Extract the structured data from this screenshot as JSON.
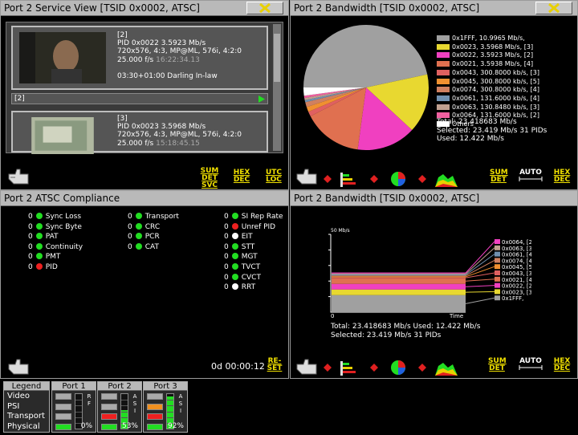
{
  "panels": {
    "service": {
      "title": "Port 2 Service View  [TSID 0x0002, ATSC]",
      "services": [
        {
          "num": "[2]",
          "pid": "PID 0x0022   3.5923 Mb/s",
          "fmt": "720x576, 4:3, MP@ML, 576i, 4:2:0",
          "rate": "25.000 f/s",
          "time": "16:22:34.13",
          "prog": "03:30+01:00 Darling In-law",
          "footer": "[2]"
        },
        {
          "num": "[3]",
          "pid": "PID 0x0023   3.5968 Mb/s",
          "fmt": "720x576, 4:3, MP@ML, 576i, 4:2:0",
          "rate": "25.000 f/s",
          "time": "15:18:45.15"
        }
      ],
      "btn_sum": [
        "SUM",
        "DET",
        "SVC"
      ],
      "btn_hex": [
        "HEX",
        "DEC"
      ],
      "btn_utc": [
        "UTC",
        "LOC"
      ]
    },
    "bandwidth_pie": {
      "title": "Port 2 Bandwidth  [TSID 0x0002, ATSC]",
      "total": "Total: 23.418683 Mb/s",
      "selected": "Selected: 23.419 Mb/s 31 PIDs",
      "used": "Used: 12.422 Mb/s",
      "btn_sum": [
        "SUM",
        "DET"
      ],
      "btn_auto": "AUTO",
      "btn_hex": [
        "HEX",
        "DEC"
      ]
    },
    "compliance": {
      "title": "Port 2 ATSC Compliance",
      "col1": [
        {
          "count": "0",
          "label": "Sync Loss",
          "status": "green"
        },
        {
          "count": "0",
          "label": "Sync Byte",
          "status": "green"
        },
        {
          "count": "0",
          "label": "PAT",
          "status": "green"
        },
        {
          "count": "0",
          "label": "Continuity",
          "status": "green"
        },
        {
          "count": "0",
          "label": "PMT",
          "status": "green"
        },
        {
          "count": "0",
          "label": "PID",
          "status": "red"
        }
      ],
      "col2": [
        {
          "count": "0",
          "label": "Transport",
          "status": "green"
        },
        {
          "count": "0",
          "label": "CRC",
          "status": "green"
        },
        {
          "count": "0",
          "label": "PCR",
          "status": "green"
        },
        {
          "count": "0",
          "label": "CAT",
          "status": "green"
        }
      ],
      "col3": [
        {
          "count": "0",
          "label": "SI Rep Rate",
          "status": "green"
        },
        {
          "count": "0",
          "label": "Unref PID",
          "status": "red"
        },
        {
          "count": "0",
          "label": "EIT",
          "status": "white"
        },
        {
          "count": "0",
          "label": "STT",
          "status": "green"
        },
        {
          "count": "0",
          "label": "MGT",
          "status": "green"
        },
        {
          "count": "0",
          "label": "TVCT",
          "status": "green"
        },
        {
          "count": "0",
          "label": "CVCT",
          "status": "green"
        },
        {
          "count": "0",
          "label": "RRT",
          "status": "white"
        }
      ],
      "timer": "0d 00:00:12",
      "reset": [
        "RE-",
        "SET"
      ]
    },
    "bandwidth_time": {
      "title": "Port 2 Bandwidth  [TSID 0x0002, ATSC]",
      "ymax": "50 Mb/s",
      "x0": "0",
      "xlabel": "Time",
      "total": "Total: 23.418683 Mb/s   Used: 12.422 Mb/s",
      "selected": "Selected: 23.419 Mb/s 31 PIDs",
      "btn_sum": [
        "SUM",
        "DET"
      ],
      "btn_auto": "AUTO",
      "btn_hex": [
        "HEX",
        "DEC"
      ]
    }
  },
  "chart_data": [
    {
      "type": "pie",
      "series": [
        {
          "name": "0x1FFF, 10.9965 Mb/s,",
          "value": 10.9965,
          "color": "#a0a0a0"
        },
        {
          "name": "0x0023, 3.5968 Mb/s, [3]",
          "value": 3.5968,
          "color": "#e8d830"
        },
        {
          "name": "0x0022, 3.5923 Mb/s, [2]",
          "value": 3.5923,
          "color": "#f040c0"
        },
        {
          "name": "0x0021, 3.5938 Mb/s, [4]",
          "value": 3.5938,
          "color": "#e07050"
        },
        {
          "name": "0x0043, 300.8000 kb/s, [3]",
          "value": 0.3008,
          "color": "#e06060"
        },
        {
          "name": "0x0045, 300.8000 kb/s, [5]",
          "value": 0.3008,
          "color": "#f09030"
        },
        {
          "name": "0x0074, 300.8000 kb/s, [4]",
          "value": 0.3008,
          "color": "#d08060"
        },
        {
          "name": "0x0061, 131.6000 kb/s, [4]",
          "value": 0.1316,
          "color": "#7090b0"
        },
        {
          "name": "0x0063, 130.8480 kb/s, [3]",
          "value": 0.1308,
          "color": "#c0a090"
        },
        {
          "name": "0x0064, 131.6000 kb/s, [2]",
          "value": 0.1316,
          "color": "#f060a0"
        },
        {
          "name": "Others",
          "value": 0.5,
          "color": "#ffffff"
        }
      ]
    },
    {
      "type": "area",
      "ylim": [
        0,
        50
      ],
      "series": [
        {
          "name": "0x0064, [2]",
          "value": 0.13,
          "color": "#f040c0"
        },
        {
          "name": "0x0063, [3]",
          "value": 0.13,
          "color": "#c0a090"
        },
        {
          "name": "0x0061, [4]",
          "value": 0.13,
          "color": "#7090b0"
        },
        {
          "name": "0x0074, [4]",
          "value": 0.3,
          "color": "#d08060"
        },
        {
          "name": "0x0045, [5]",
          "value": 0.3,
          "color": "#f09030"
        },
        {
          "name": "0x0043, [3]",
          "value": 0.3,
          "color": "#e06060"
        },
        {
          "name": "0x0021, [4]",
          "value": 3.59,
          "color": "#e07050"
        },
        {
          "name": "0x0022, [2]",
          "value": 3.59,
          "color": "#f040c0"
        },
        {
          "name": "0x0023, [3]",
          "value": 3.6,
          "color": "#e8d830"
        },
        {
          "name": "0x1FFF,",
          "value": 11.0,
          "color": "#a0a0a0"
        }
      ]
    }
  ],
  "legend": {
    "title": "Legend",
    "rows": [
      "Video",
      "PSI",
      "Transport",
      "Physical"
    ],
    "ports": [
      {
        "name": "Port 1",
        "side": "R F",
        "pct": "0%",
        "bars": [
          "#aaaaaa",
          "#aaaaaa",
          "#aaaaaa",
          "#22dd22"
        ],
        "level": 0
      },
      {
        "name": "Port 2",
        "side": "A S I",
        "pct": "53%",
        "bars": [
          "#aaaaaa",
          "#aaaaaa",
          "#ee2020",
          "#22dd22"
        ],
        "level": 0.53
      },
      {
        "name": "Port 3",
        "side": "A S I",
        "pct": "92%",
        "bars": [
          "#aaaaaa",
          "#f09020",
          "#ee2020",
          "#22dd22"
        ],
        "level": 0.92
      }
    ]
  }
}
